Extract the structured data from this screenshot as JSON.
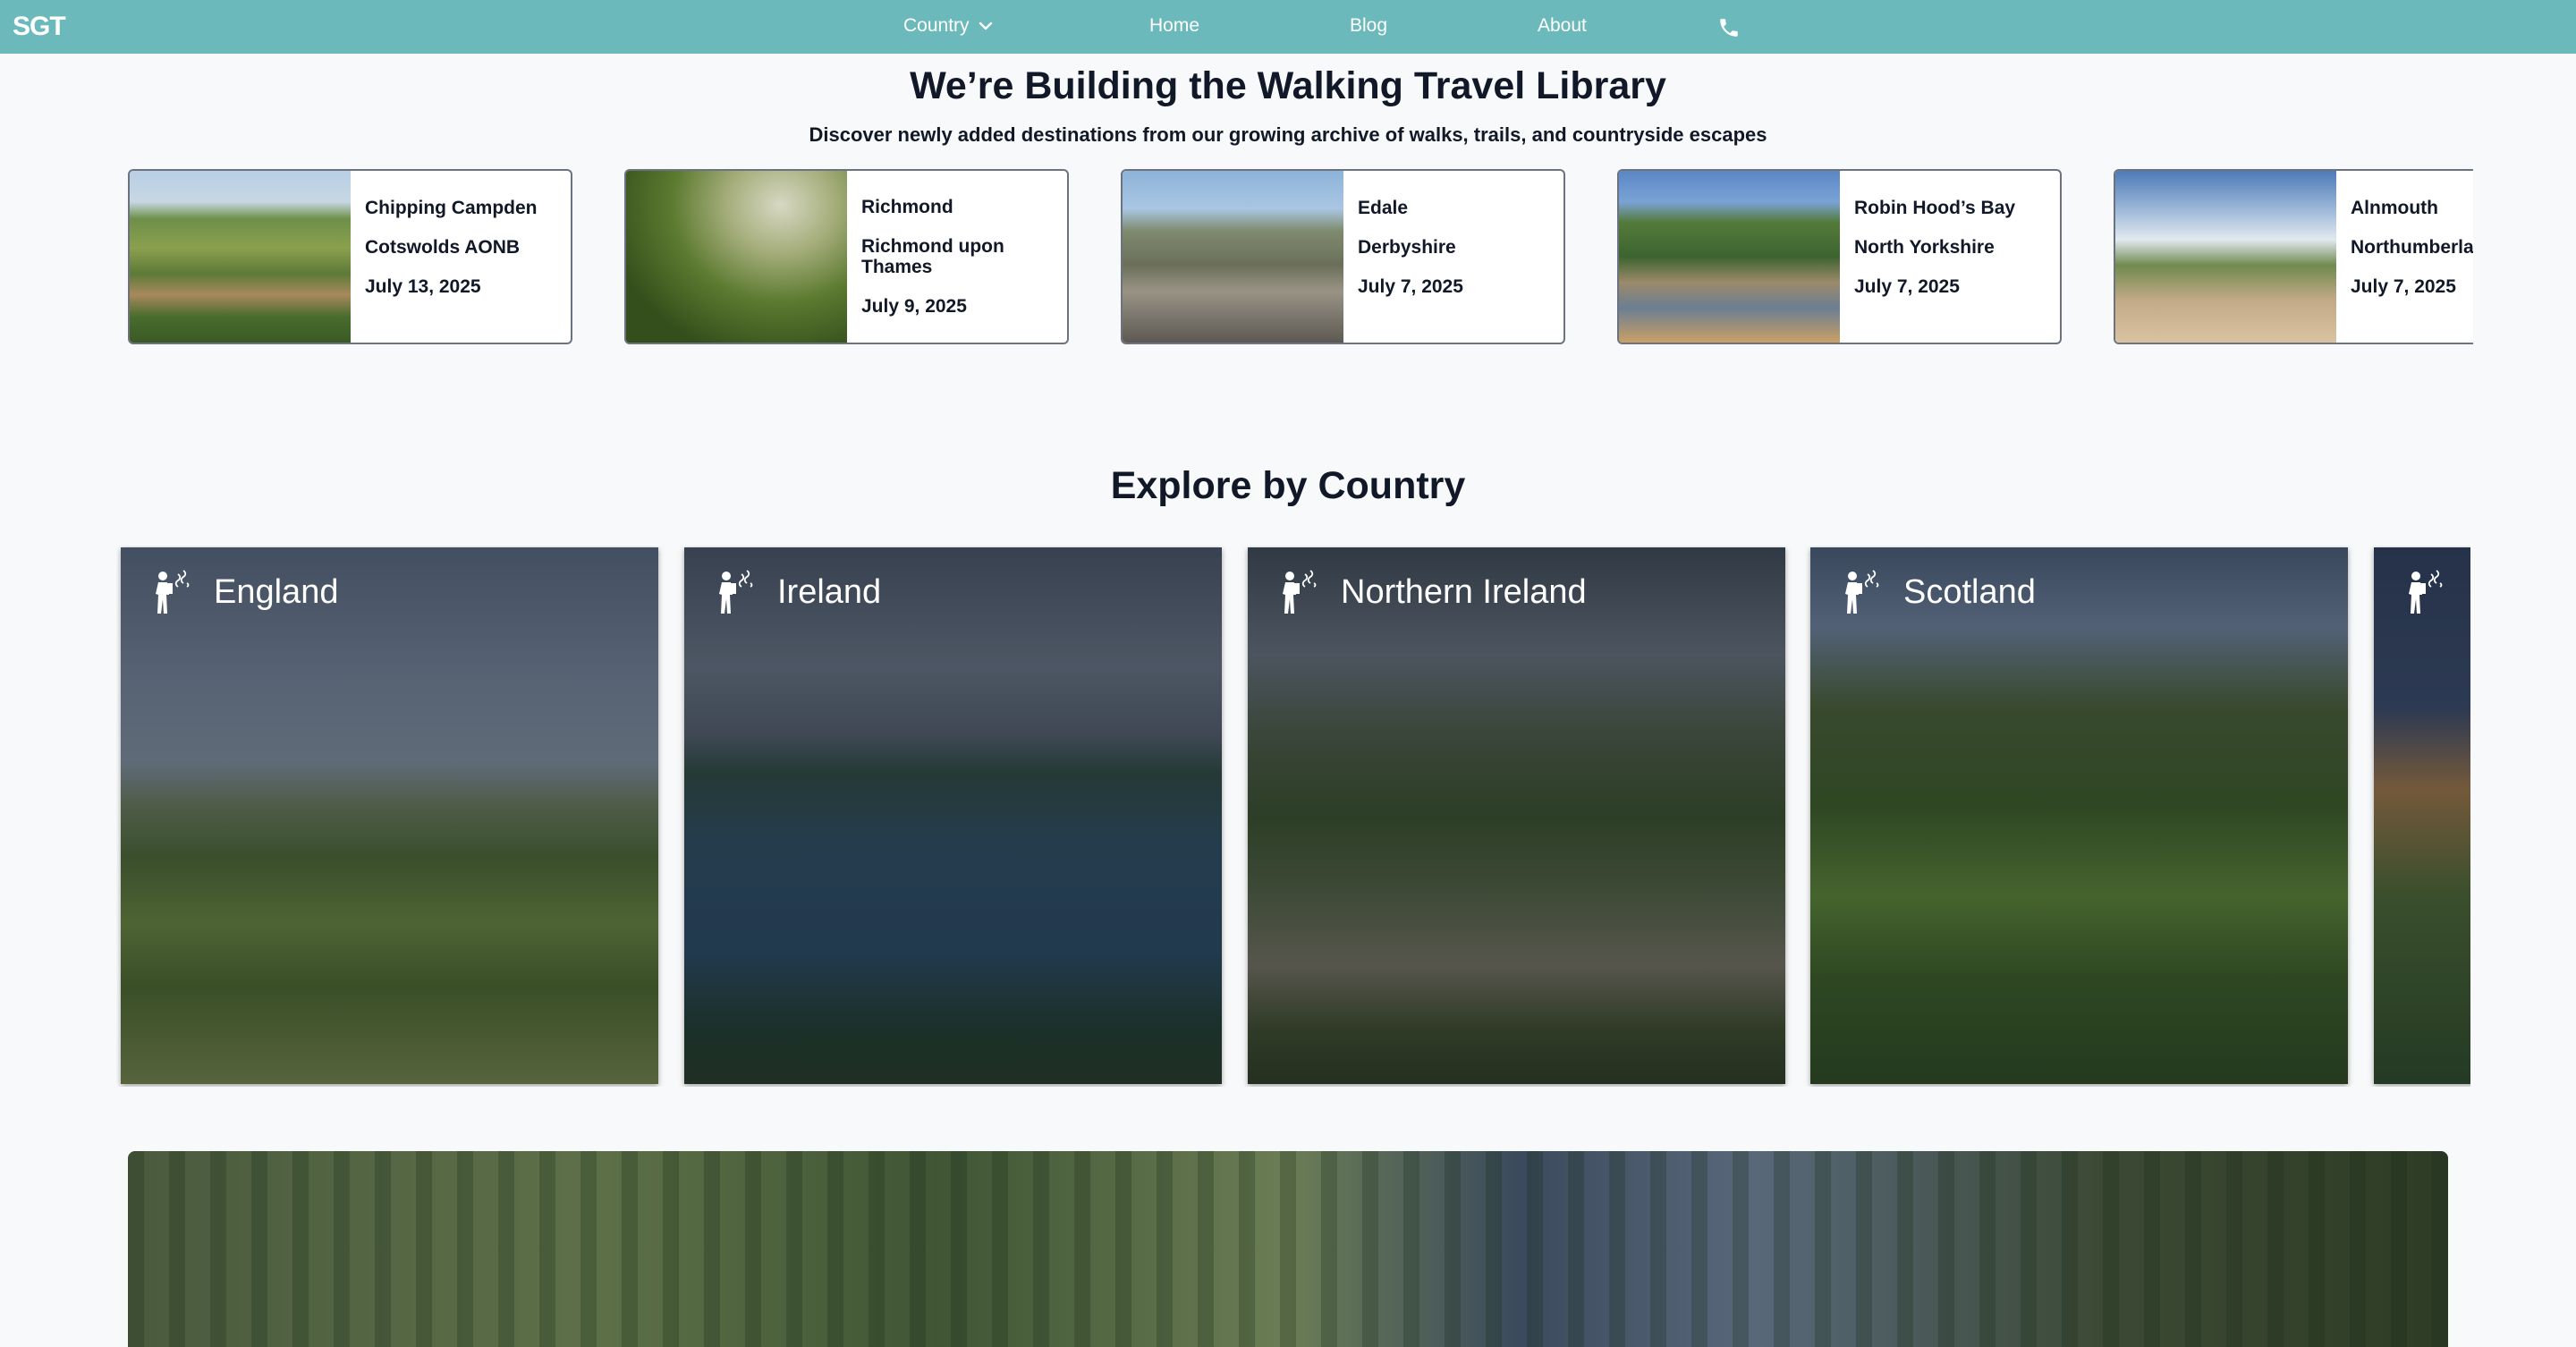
{
  "nav": {
    "logo": "SGT",
    "country_label": "Country",
    "home_label": "Home",
    "blog_label": "Blog",
    "about_label": "About",
    "phone_icon": "phone-icon",
    "dropdown_icon": "chevron-down-icon"
  },
  "hero": {
    "title": "We’re Building the Walking Travel Library",
    "subtitle": "Discover newly added destinations from our growing archive of walks, trails, and countryside escapes"
  },
  "destinations": [
    {
      "name": "Chipping Campden",
      "region": "Cotswolds AONB",
      "date": "July 13, 2025"
    },
    {
      "name": "Richmond",
      "region": "Richmond upon Thames",
      "date": "July 9, 2025"
    },
    {
      "name": "Edale",
      "region": "Derbyshire",
      "date": "July 7, 2025"
    },
    {
      "name": "Robin Hood’s Bay",
      "region": "North Yorkshire",
      "date": "July 7, 2025"
    },
    {
      "name": "Alnmouth",
      "region": "Northumberland",
      "date": "July 7, 2025"
    }
  ],
  "explore": {
    "title": "Explore by Country",
    "countries": [
      {
        "name": "England"
      },
      {
        "name": "Ireland"
      },
      {
        "name": "Northern Ireland"
      },
      {
        "name": "Scotland"
      },
      {
        "name": ""
      }
    ],
    "country_icon": "hiker-icon"
  }
}
